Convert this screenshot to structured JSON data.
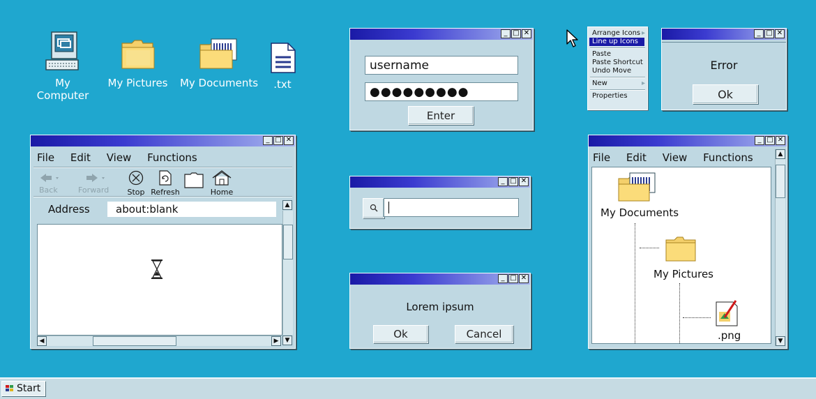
{
  "desktop": {
    "icons": [
      {
        "label": "My Computer",
        "icon": "computer-icon"
      },
      {
        "label": "My Pictures",
        "icon": "folder-icon"
      },
      {
        "label": "My Documents",
        "icon": "documents-folder-icon"
      },
      {
        "label": ".txt",
        "icon": "text-file-icon"
      }
    ]
  },
  "login": {
    "username": "username",
    "password": "●●●●●●●●●",
    "enter_label": "Enter"
  },
  "search": {
    "value": ""
  },
  "message": {
    "text": "Lorem ipsum",
    "ok_label": "Ok",
    "cancel_label": "Cancel"
  },
  "context_menu": {
    "items": [
      "Arrange Icons",
      "Line up Icons",
      "Paste",
      "Paste Shortcut",
      "Undo Move",
      "New",
      "Properties"
    ]
  },
  "error": {
    "text": "Error",
    "ok_label": "Ok"
  },
  "browser": {
    "menu": [
      "File",
      "Edit",
      "View",
      "Functions"
    ],
    "toolbar": {
      "back": "Back",
      "forward": "Forward",
      "stop": "Stop",
      "refresh": "Refresh",
      "home": "Home"
    },
    "address_label": "Address",
    "address_value": "about:blank"
  },
  "explorer": {
    "menu": [
      "File",
      "Edit",
      "View",
      "Functions"
    ],
    "tree": {
      "root": "My Documents",
      "child": "My Pictures",
      "file": ".png"
    }
  },
  "taskbar": {
    "start_label": "Start"
  },
  "window_buttons": {
    "minimize": "_",
    "maximize": "□",
    "close": "✕"
  },
  "colors": {
    "desktop": "#1fa7cf",
    "title_start": "#1a1aa6",
    "window": "#bfd8e2"
  }
}
